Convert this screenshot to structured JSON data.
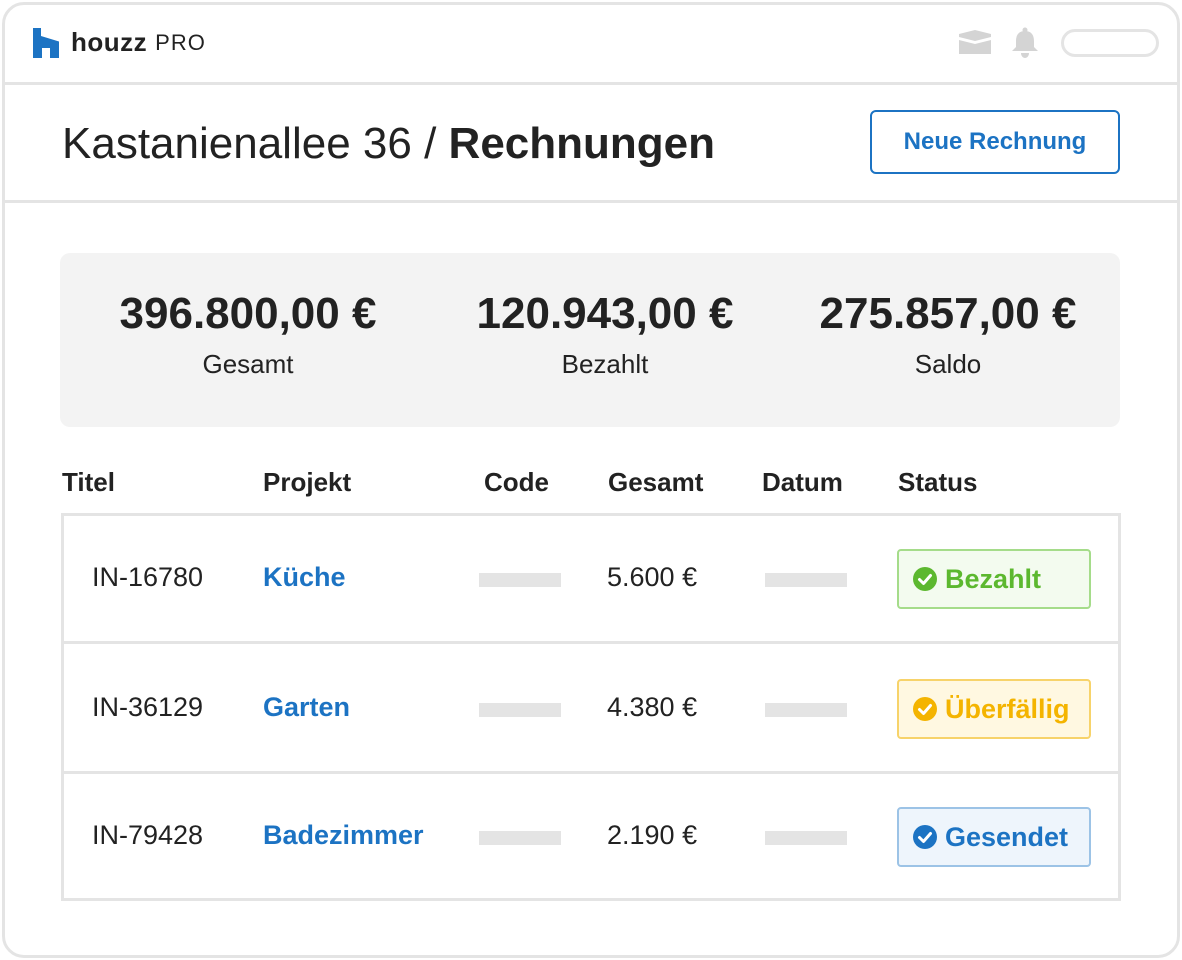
{
  "app": {
    "logo_word": "houzz",
    "logo_pro": "PRO",
    "brand_color": "#1c73c3",
    "icons": [
      "houzz-logo-icon",
      "mail-icon",
      "bell-icon"
    ]
  },
  "header": {
    "breadcrumb": "Kastanienallee 36",
    "separator": "/",
    "title": "Rechnungen",
    "new_button_label": "Neue Rechnung"
  },
  "summary": [
    {
      "value": "396.800,00 €",
      "label": "Gesamt"
    },
    {
      "value": "120.943,00 €",
      "label": "Bezahlt"
    },
    {
      "value": "275.857,00 €",
      "label": "Saldo"
    }
  ],
  "table": {
    "columns": [
      "Titel",
      "Projekt",
      "Code",
      "Gesamt",
      "Datum",
      "Status"
    ],
    "rows": [
      {
        "title": "IN-16780",
        "project": "Küche",
        "total": "5.600 €",
        "status": "Bezahlt",
        "status_icon": "check-circle-icon",
        "status_color": "#5cb82f",
        "status_bg": "#f3fbef",
        "status_border": "#a5dc8a"
      },
      {
        "title": "IN-36129",
        "project": "Garten",
        "total": "4.380 €",
        "status": "Überfällig",
        "status_icon": "check-circle-icon",
        "status_color": "#f4b400",
        "status_bg": "#fff8e1",
        "status_border": "#f7d36a"
      },
      {
        "title": "IN-79428",
        "project": "Badezimmer",
        "total": "2.190 €",
        "status": "Gesendet",
        "status_icon": "check-circle-icon",
        "status_color": "#1c73c3",
        "status_bg": "#eef5fc",
        "status_border": "#9cc3e6"
      }
    ]
  }
}
